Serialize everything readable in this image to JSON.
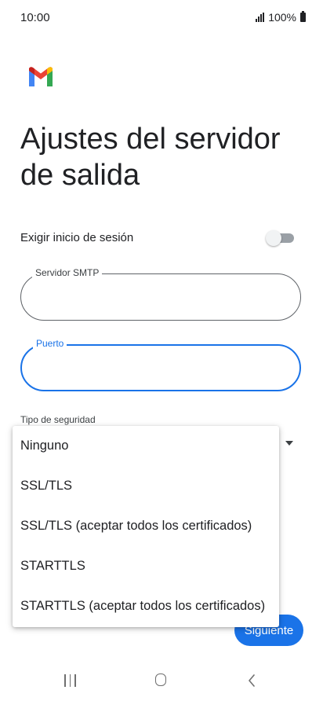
{
  "status_bar": {
    "time": "10:00",
    "battery": "100%"
  },
  "header": {
    "logo": "gmail-logo"
  },
  "page": {
    "title": "Ajustes del servidor de salida"
  },
  "form": {
    "require_login": {
      "label": "Exigir inicio de sesión",
      "enabled": false
    },
    "smtp_server": {
      "label": "Servidor SMTP",
      "value": ""
    },
    "port": {
      "label": "Puerto",
      "value": ""
    },
    "security": {
      "label": "Tipo de seguridad"
    }
  },
  "security_menu": {
    "options": [
      "Ninguno",
      "SSL/TLS",
      "SSL/TLS (aceptar todos los certificados)",
      "STARTTLS",
      "STARTTLS (aceptar todos los certificados)"
    ]
  },
  "actions": {
    "next_label": "Siguiente"
  },
  "nav_bar": {
    "icons": [
      "recents-icon",
      "home-icon",
      "back-icon"
    ]
  },
  "colors": {
    "accent": "#1a73e8",
    "gmail_red": "#ea4335",
    "gmail_blue": "#4285f4",
    "gmail_green": "#34a853",
    "gmail_yellow": "#fbbc04"
  }
}
